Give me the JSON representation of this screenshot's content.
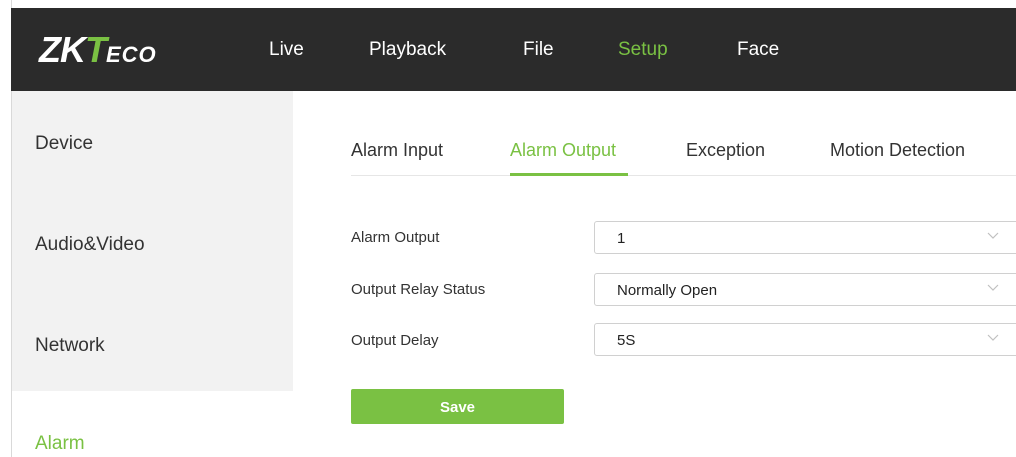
{
  "logo": {
    "main": "ZK",
    "tee": "T",
    "rest": "ECO",
    "text": "ZKTeco"
  },
  "nav": {
    "items": [
      {
        "label": "Live"
      },
      {
        "label": "Playback"
      },
      {
        "label": "File"
      },
      {
        "label": "Setup",
        "active": true
      },
      {
        "label": "Face"
      }
    ]
  },
  "sidebar": {
    "items": [
      {
        "label": "Device"
      },
      {
        "label": "Audio&Video"
      },
      {
        "label": "Network"
      },
      {
        "label": "Alarm",
        "active": true
      }
    ]
  },
  "tabs": [
    {
      "label": "Alarm Input"
    },
    {
      "label": "Alarm Output",
      "active": true
    },
    {
      "label": "Exception"
    },
    {
      "label": "Motion Detection"
    }
  ],
  "form": {
    "alarm_output": {
      "label": "Alarm Output",
      "value": "1"
    },
    "relay_status": {
      "label": "Output Relay Status",
      "value": "Normally Open"
    },
    "output_delay": {
      "label": "Output Delay",
      "value": "5S"
    }
  },
  "save_label": "Save",
  "colors": {
    "accent": "#7ac143",
    "topbar": "#2b2b2b",
    "sidebar": "#f2f2f2"
  },
  "icons": {
    "dropdown": "chevron-down-icon"
  }
}
